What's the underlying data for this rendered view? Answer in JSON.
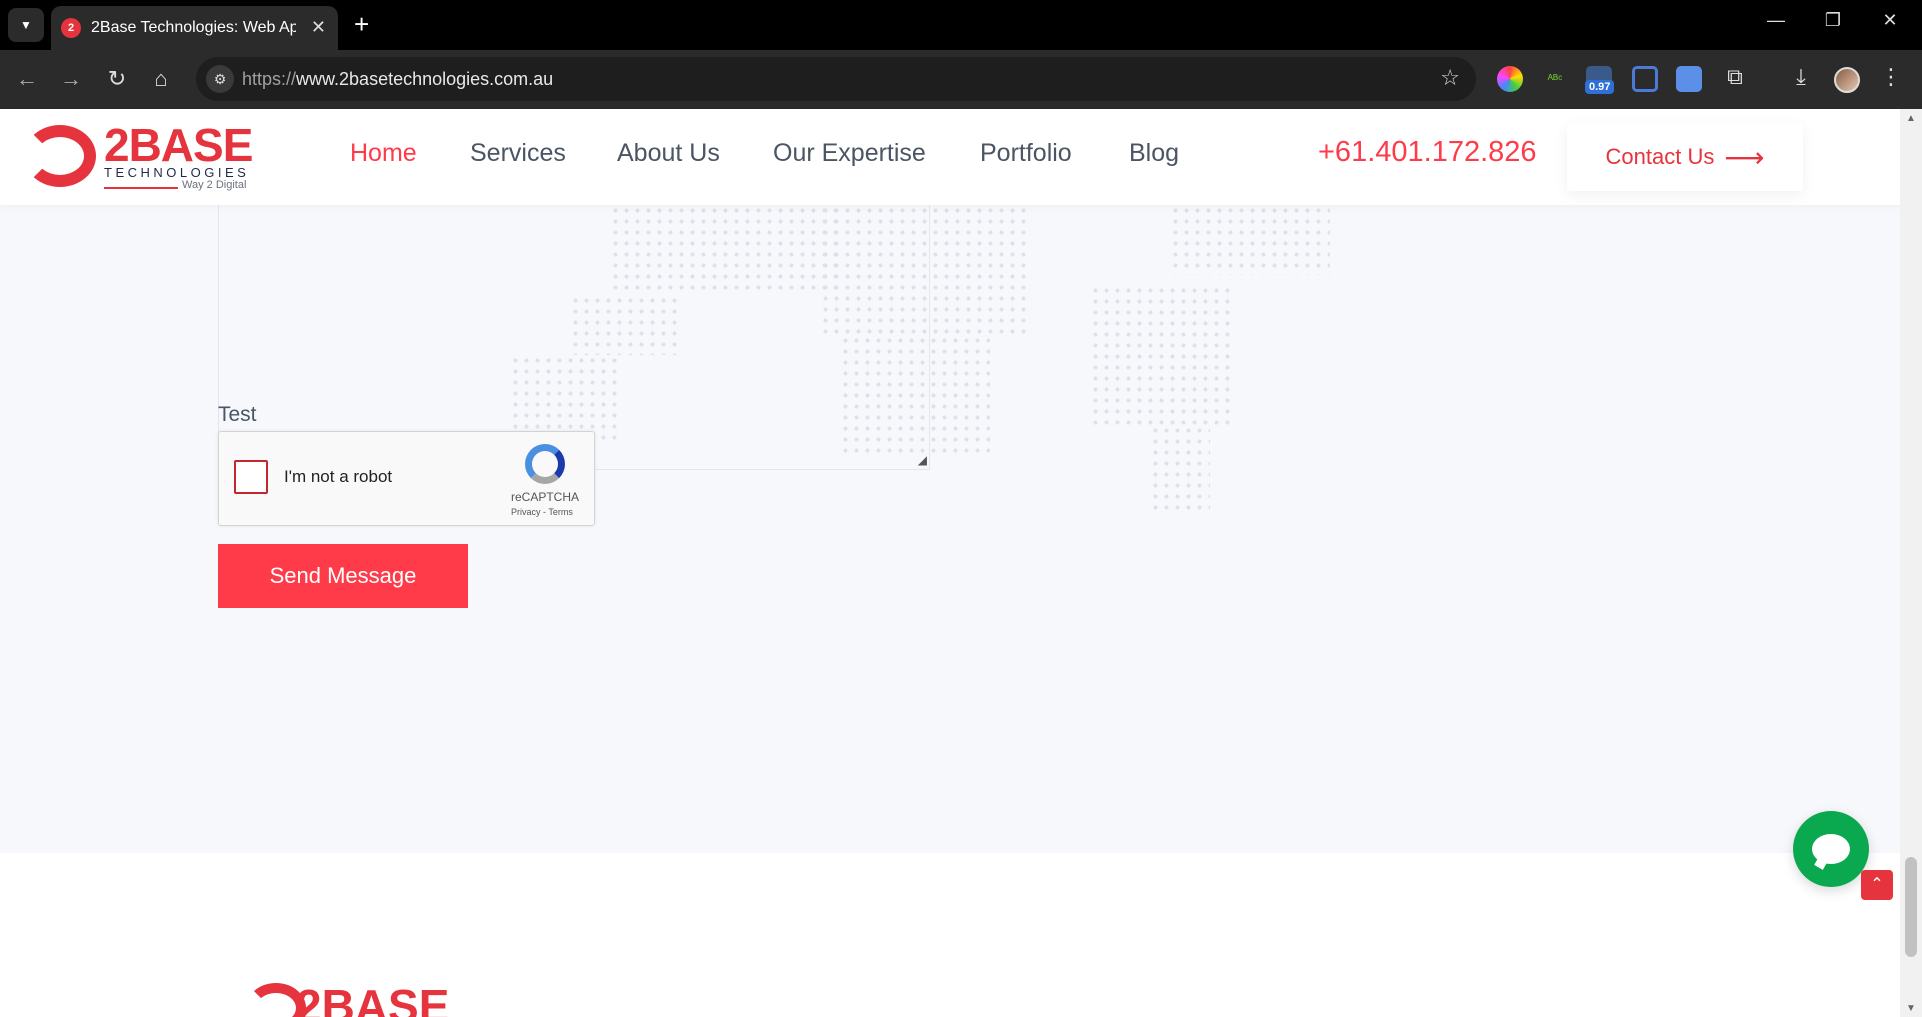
{
  "browser": {
    "tab_title": "2Base Technologies: Web Applic",
    "url_scheme": "https://",
    "url_host": "www.2basetechnologies.com.au",
    "extension_badge": "0.97"
  },
  "header": {
    "logo_text": "2BASE",
    "logo_sub": "TECHNOLOGIES",
    "logo_tagline": "Way 2 Digital",
    "nav": [
      {
        "label": "Home",
        "active": true
      },
      {
        "label": "Services",
        "active": false
      },
      {
        "label": "About Us",
        "active": false
      },
      {
        "label": "Our Expertise",
        "active": false
      },
      {
        "label": "Portfolio",
        "active": false
      },
      {
        "label": "Blog",
        "active": false
      }
    ],
    "phone": "+61.401.172.826",
    "contact_label": "Contact Us",
    "contact_arrow": "⟶"
  },
  "form": {
    "captcha_field_label": "Test",
    "recaptcha_label": "I'm not a robot",
    "recaptcha_brand": "reCAPTCHA",
    "recaptcha_links": "Privacy - Terms",
    "submit_label": "Send Message"
  },
  "footer": {
    "logo_text": "2BASE"
  },
  "colors": {
    "brand_red": "#e5343d",
    "accent_red": "#ff3b4a",
    "chat_green": "#0aa84f"
  }
}
